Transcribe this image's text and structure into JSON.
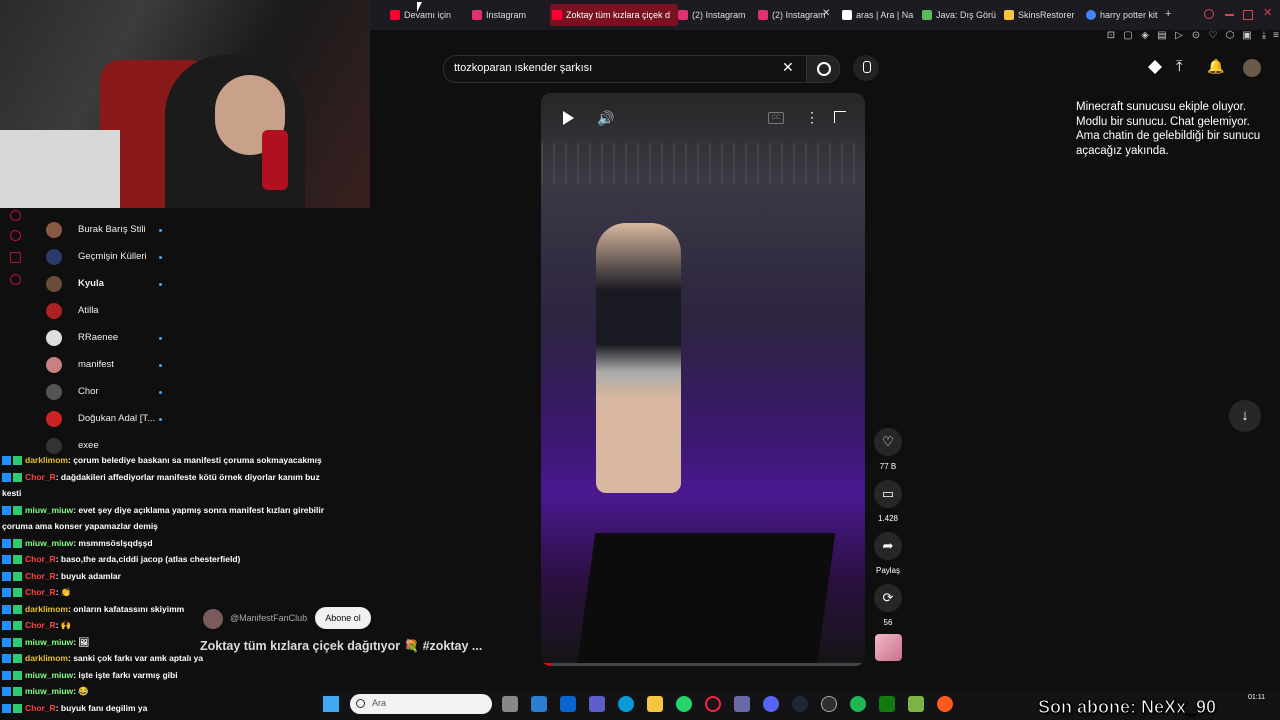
{
  "browser": {
    "tabs": [
      {
        "label": "Devamı için",
        "color": "#ff0033",
        "active": false
      },
      {
        "label": "Instagram",
        "color": "#e1306c",
        "active": false
      },
      {
        "label": "Zoktay tüm kızlara çiçek d",
        "color": "#ff0033",
        "active": true
      },
      {
        "label": "(2) Instagram",
        "color": "#e1306c",
        "active": false
      },
      {
        "label": "(2) Instagram",
        "color": "#e1306c",
        "active": false
      },
      {
        "label": "aras | Ara | Na",
        "color": "#ffffff",
        "active": false
      },
      {
        "label": "Java: Dış Görü",
        "color": "#5cb85c",
        "active": false
      },
      {
        "label": "SkinsRestorer",
        "color": "#f5c542",
        "active": false
      },
      {
        "label": "harry potter kit",
        "color": "#4285f4",
        "active": false
      }
    ]
  },
  "youtube": {
    "search_value": "ttozkoparan ıskender şarkısı",
    "video": {
      "title": "Zoktay tüm kızlara çiçek dağıtıyor 💐 #zoktay ...",
      "channel": "@ManifestFanClub",
      "subscribe_label": "Abone ol"
    },
    "actions": {
      "likes": "77 B",
      "comments": "1.428",
      "share_label": "Paylaş",
      "remix_count": "56"
    },
    "subscriptions": [
      {
        "name": "Burak Barış Stili",
        "color": "#8a5a44"
      },
      {
        "name": "Geçmişin Külleri",
        "color": "#2a3a6a"
      },
      {
        "name": "Kyula",
        "color": "#6a4a3a"
      },
      {
        "name": "Atilla",
        "color": "#aa2222"
      },
      {
        "name": "RRaenee",
        "color": "#dddddd"
      },
      {
        "name": "manifest",
        "color": "#c88080"
      },
      {
        "name": "Chor",
        "color": "#555555"
      },
      {
        "name": "Doğukan Adal [T...",
        "color": "#cc2222"
      },
      {
        "name": "exee",
        "color": "#333333"
      }
    ]
  },
  "overlay": {
    "stream_note": [
      "Minecraft sunucusu ekiple oluyor.",
      "Modlu bir sunucu. Chat gelemiyor.",
      "Ama chatin de gelebildiği bir sunucu",
      "açacağız yakında."
    ],
    "last_sub": "Son abone: NeXx_90"
  },
  "chat": [
    {
      "user": "darklimom",
      "color": "#e6c229",
      "msg": ": çorum belediye baskanı sa manifesti çoruma sokmayacakmış"
    },
    {
      "user": "Chor_R",
      "color": "#ff4040",
      "msg": ": dağdakileri affediyorlar manifeste kötü örnek diyorlar kanım buz"
    },
    {
      "user": "",
      "color": "#ffffff",
      "msg": "kesti"
    },
    {
      "user": "miuw_miuw",
      "color": "#7fff7f",
      "msg": ": evet şey diye açıklama yapmış sonra manifest kızları girebilir"
    },
    {
      "user": "",
      "color": "#ffffff",
      "msg": "çoruma ama konser yapamazlar demiş"
    },
    {
      "user": "miuw_miuw",
      "color": "#7fff7f",
      "msg": ": msmmsöslşqdşşd"
    },
    {
      "user": "Chor_R",
      "color": "#ff4040",
      "msg": ": baso,the arda,ciddi jacop (atlas chesterfield)"
    },
    {
      "user": "Chor_R",
      "color": "#ff4040",
      "msg": ": buyuk adamlar"
    },
    {
      "user": "Chor_R",
      "color": "#ff4040",
      "msg": ": 👏"
    },
    {
      "user": "darklimom",
      "color": "#e6c229",
      "msg": ": onların kafatassını skiyimm"
    },
    {
      "user": "Chor_R",
      "color": "#ff4040",
      "msg": ": 🙌"
    },
    {
      "user": "miuw_miuw",
      "color": "#7fff7f",
      "msg": ": 🖼"
    },
    {
      "user": "darklimom",
      "color": "#e6c229",
      "msg": ": sanki çok farkı var amk aptalı ya"
    },
    {
      "user": "miuw_miuw",
      "color": "#7fff7f",
      "msg": ": işte işte farkı varmış gibi"
    },
    {
      "user": "miuw_miuw",
      "color": "#7fff7f",
      "msg": ": 😂"
    },
    {
      "user": "Chor_R",
      "color": "#ff4040",
      "msg": ": buyuk fanı degilim ya"
    }
  ],
  "taskbar": {
    "search_placeholder": "Ara",
    "time": "01:11"
  }
}
